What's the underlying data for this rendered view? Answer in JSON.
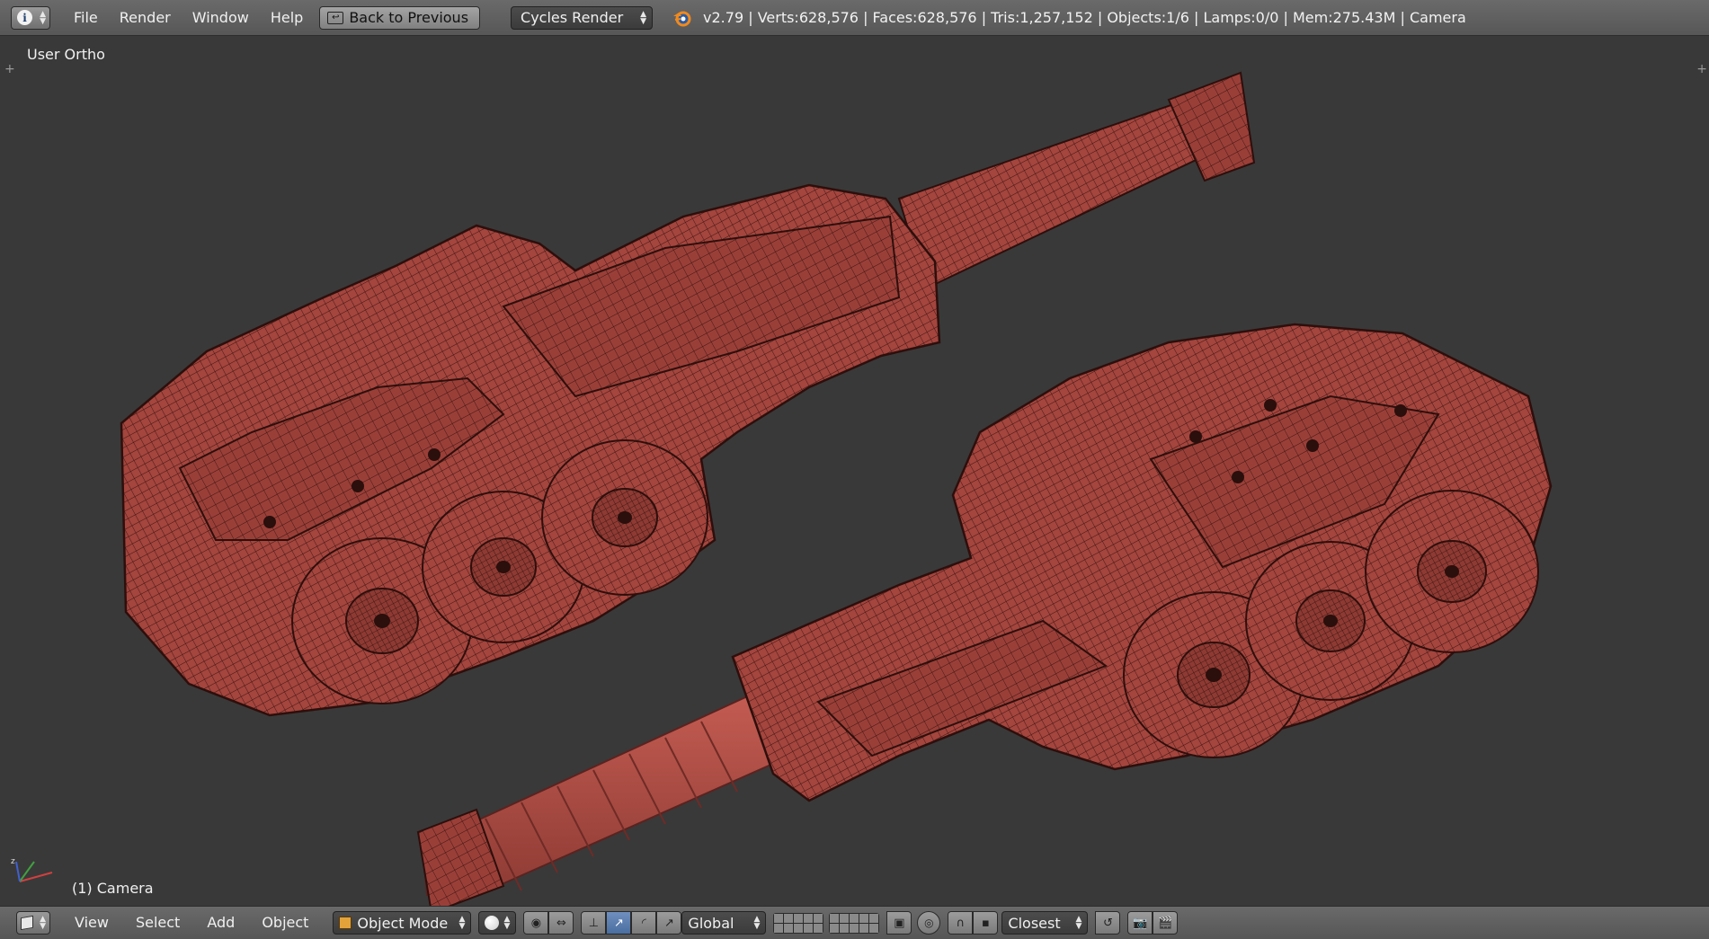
{
  "top_header": {
    "editor_type_icon": "info-icon",
    "menu": [
      "File",
      "Render",
      "Window",
      "Help"
    ],
    "back_button": "Back to Previous",
    "render_engine": "Cycles Render",
    "logo_icon": "blender-logo-icon",
    "stats": "v2.79 | Verts:628,576 | Faces:628,576 | Tris:1,257,152 | Objects:1/6 | Lamps:0/0 | Mem:275.43M | Camera"
  },
  "viewport": {
    "view_label": "User Ortho",
    "object_label": "(1) Camera",
    "mesh_color": "#a4453e",
    "wire_color": "#3a1410",
    "background": "#393939"
  },
  "bottom_header": {
    "editor_type_icon": "3d-view-icon",
    "menu": [
      "View",
      "Select",
      "Add",
      "Object"
    ],
    "mode": "Object Mode",
    "viewport_shading_icon": "solid-sphere-icon",
    "transform_orientation": "Global",
    "snap_target": "Closest"
  }
}
